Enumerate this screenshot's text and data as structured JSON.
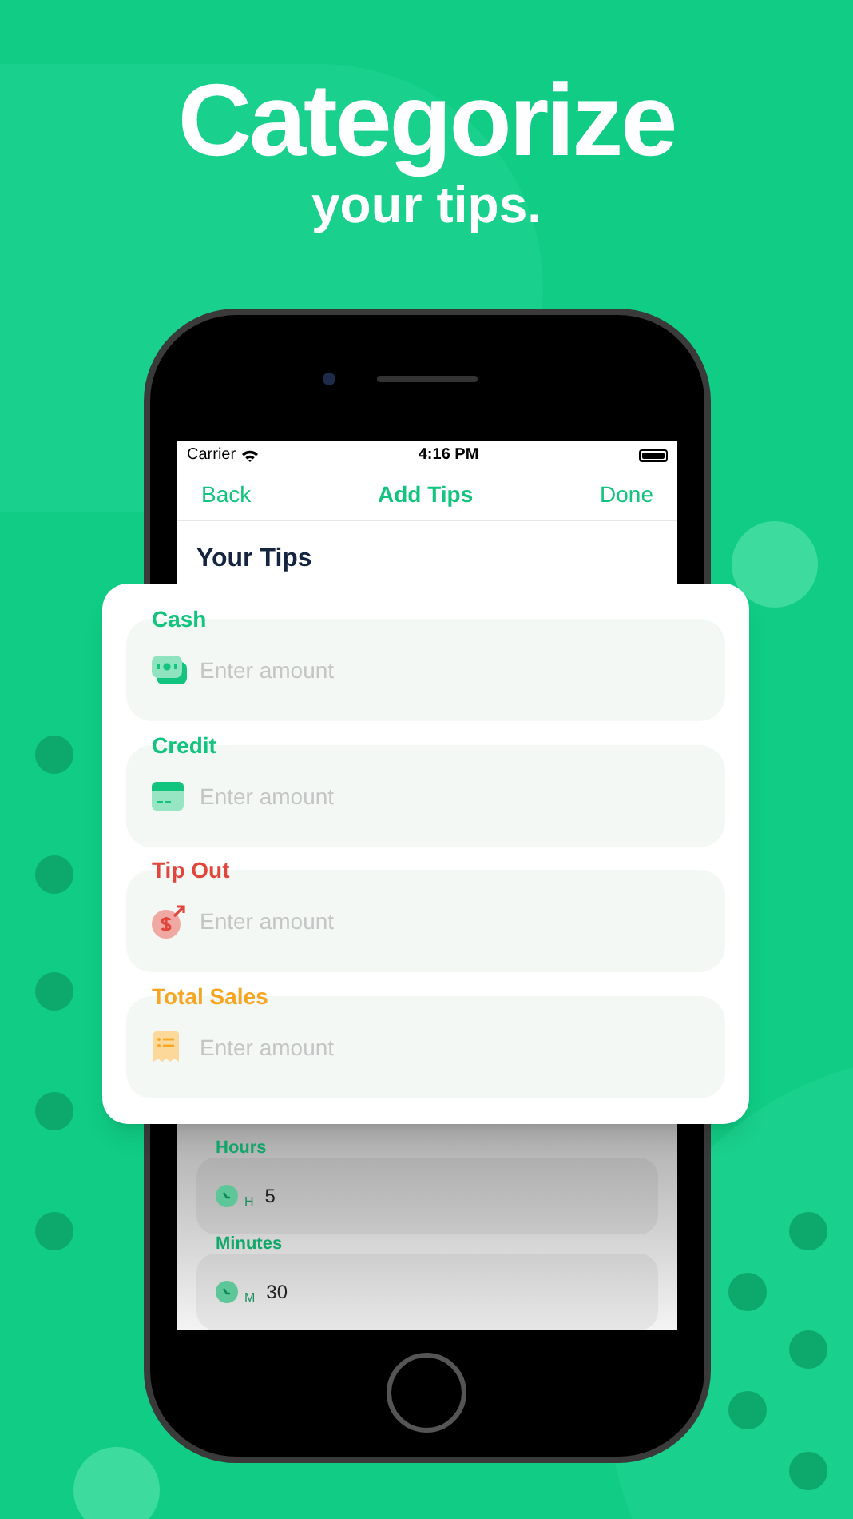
{
  "headline": {
    "title": "Categorize",
    "subtitle": "your tips."
  },
  "status_bar": {
    "carrier": "Carrier",
    "time": "4:16 PM"
  },
  "nav": {
    "back": "Back",
    "title": "Add Tips",
    "done": "Done"
  },
  "section_title": "Your Tips",
  "tip_fields": [
    {
      "label": "Cash",
      "kind": "cash",
      "color": "#12c47d",
      "placeholder": "Enter amount"
    },
    {
      "label": "Credit",
      "kind": "credit",
      "color": "#12c47d",
      "placeholder": "Enter amount"
    },
    {
      "label": "Tip Out",
      "kind": "tipout",
      "color": "#e0463c",
      "placeholder": "Enter amount"
    },
    {
      "label": "Total Sales",
      "kind": "sales",
      "color": "#f5a623",
      "placeholder": "Enter amount"
    }
  ],
  "time_fields": [
    {
      "label": "Hours",
      "unit": "H",
      "value": "5"
    },
    {
      "label": "Minutes",
      "unit": "M",
      "value": "30"
    }
  ]
}
